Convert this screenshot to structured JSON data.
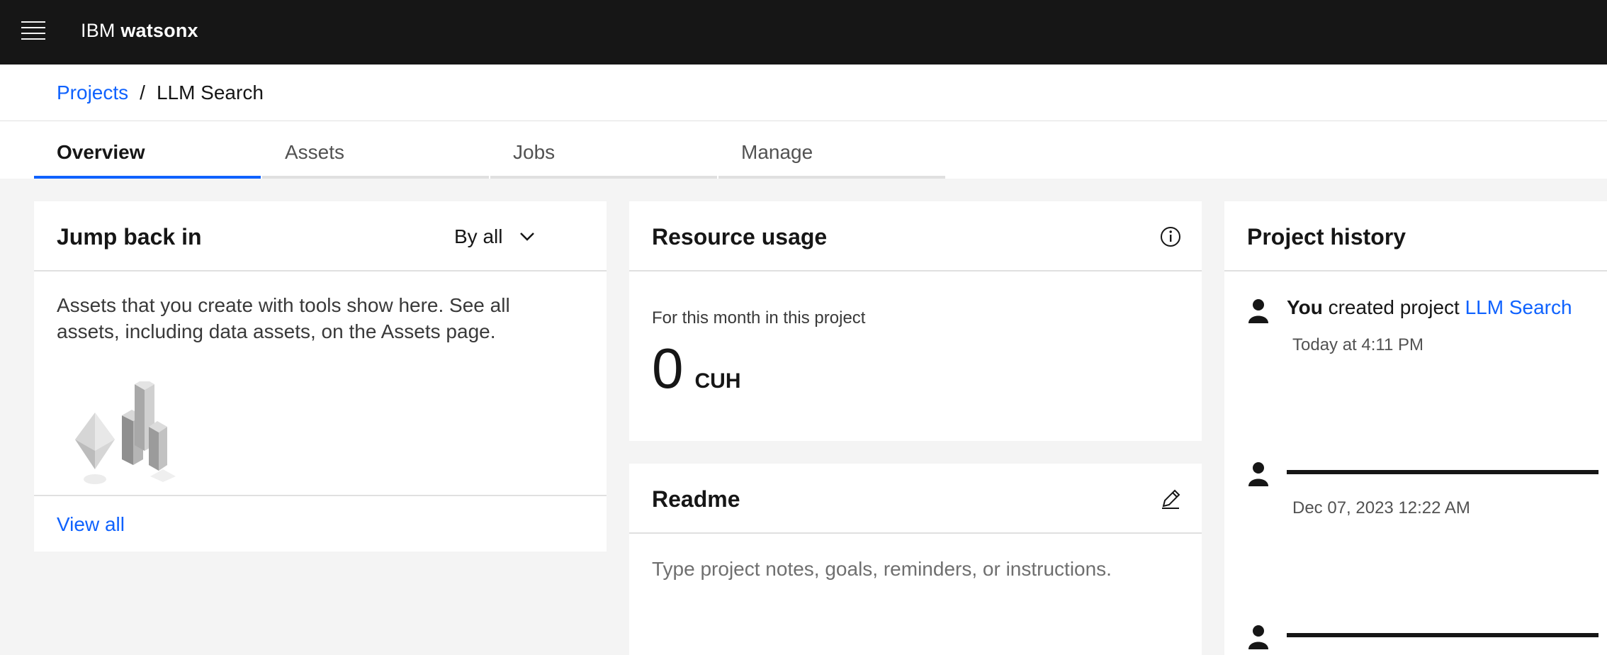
{
  "header": {
    "brand_prefix": "IBM",
    "brand_name": "watsonx",
    "menu_icon": "hamburger-menu-icon"
  },
  "breadcrumb": {
    "parent": "Projects",
    "separator": "/",
    "current": "LLM Search"
  },
  "tabs": [
    {
      "label": "Overview",
      "active": true
    },
    {
      "label": "Assets",
      "active": false
    },
    {
      "label": "Jobs",
      "active": false
    },
    {
      "label": "Manage",
      "active": false
    }
  ],
  "jump_back": {
    "title": "Jump back in",
    "filter_label": "By all",
    "description": "Assets that you create with tools show here. See all assets, including data assets, on the Assets page.",
    "view_all": "View all"
  },
  "resource_usage": {
    "title": "Resource usage",
    "period_label": "For this month in this project",
    "value": "0",
    "unit": "CUH"
  },
  "readme": {
    "title": "Readme",
    "placeholder": "Type project notes, goals, reminders, or instructions."
  },
  "history": {
    "title": "Project history",
    "items": [
      {
        "actor": "You",
        "action": "created project",
        "target": "LLM Search",
        "time": "Today at 4:11 PM"
      },
      {
        "actor": "",
        "action": "",
        "target": "",
        "time": "Dec 07, 2023 12:22 AM"
      },
      {
        "actor": "",
        "action": "",
        "target": "",
        "time": ""
      }
    ]
  },
  "colors": {
    "accent": "#0f62fe",
    "topbar": "#161616",
    "background": "#f4f4f4"
  }
}
